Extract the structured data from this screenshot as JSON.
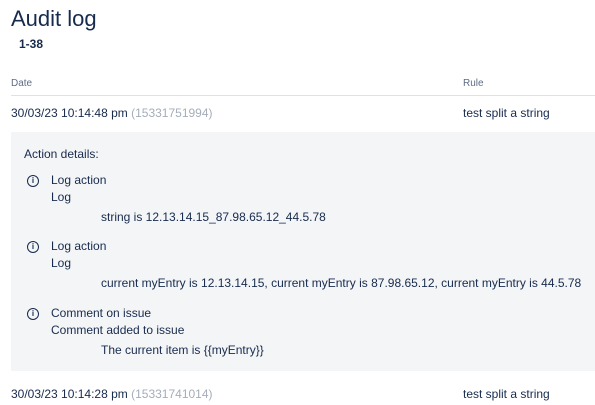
{
  "page": {
    "title": "Audit log",
    "range": "1-38"
  },
  "columns": {
    "date": "Date",
    "rule": "Rule"
  },
  "rows": [
    {
      "date": "30/03/23 10:14:48 pm",
      "id": "(15331751994)",
      "rule": "test split a string"
    },
    {
      "date": "30/03/23 10:14:28 pm",
      "id": "(15331741014)",
      "rule": "test split a string"
    }
  ],
  "details": {
    "title": "Action details:",
    "actions": [
      {
        "name": "Log action",
        "type": "Log",
        "message": "string is 12.13.14.15_87.98.65.12_44.5.78",
        "icon": "info-icon"
      },
      {
        "name": "Log action",
        "type": "Log",
        "message": "current myEntry is 12.13.14.15, current myEntry is 87.98.65.12, current myEntry is 44.5.78",
        "icon": "info-icon"
      },
      {
        "name": "Comment on issue",
        "type": "Comment added to issue",
        "message": "The current item is {{myEntry}}",
        "icon": "info-icon"
      }
    ]
  }
}
